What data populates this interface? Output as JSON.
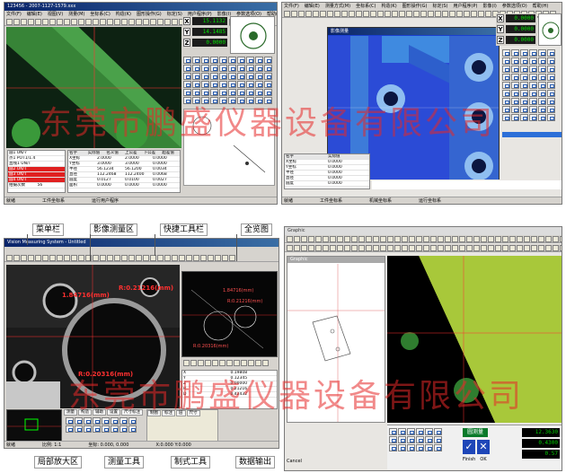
{
  "watermark": {
    "text": "东莞市鹏盛仪器设备有限公司",
    "color": "#e62828"
  },
  "panel_top_left": {
    "title": "123456 - 2007-1127-1579.xxx",
    "menu": [
      "文件(F)",
      "编辑(E)",
      "视图(V)",
      "测量(M)",
      "坐标系(C)",
      "构造(K)",
      "图形操作(G)",
      "标定(S)",
      "用户程序(P)",
      "影像(I)",
      "参数选项(O)",
      "帮助(H)"
    ],
    "readout": [
      {
        "axis": "X",
        "value": "15.1132"
      },
      {
        "axis": "Y",
        "value": "14.1485"
      },
      {
        "axis": "Z",
        "value": "0.0000"
      }
    ],
    "table_headers": [
      "名字",
      "实际值",
      "名义值",
      "上公差",
      "下公差",
      "超差值"
    ],
    "table_rows": [
      [
        "X坐标",
        "2.0000",
        "2.0000",
        "0.0000"
      ],
      [
        "Y坐标",
        "3.0000",
        "3.0000",
        "0.0000"
      ],
      [
        "半径",
        "56.1234",
        "56.1200",
        "0.0034"
      ],
      [
        "直径",
        "112.2468",
        "112.2400",
        "0.0068"
      ],
      [
        "圆度",
        "0.0127",
        "0.0100",
        "0.0027"
      ],
      [
        "面积",
        "0.0000",
        "0.0000",
        "0.0000"
      ]
    ],
    "feature_list": [
      "圆1 UN/7",
      "点1 POT1/1.4",
      "直线1 UN/T",
      "圆2 UN/T",
      "圆3 UN/T",
      "圆4 UN/T"
    ],
    "status": [
      "就绪",
      "工件坐标系",
      "运行用户程序"
    ],
    "image_count_label": "拍摄次数",
    "image_count": "56"
  },
  "panel_top_right": {
    "menu": [
      "文件(F)",
      "编辑(E)",
      "测量方式(M)",
      "坐标系(C)",
      "构造(K)",
      "图形操作(G)",
      "标定(S)",
      "用户程序(P)",
      "影像(I)",
      "参数选项(O)",
      "帮助(H)"
    ],
    "subwindow_title": "影像测量",
    "readout": [
      {
        "axis": "X",
        "value": "0.0000"
      },
      {
        "axis": "Y",
        "value": "0.0000"
      },
      {
        "axis": "Z",
        "value": "0.0000"
      }
    ],
    "table_headers": [
      "名字",
      "实际值"
    ],
    "table_rows": [
      [
        "X坐标",
        "0.0000"
      ],
      [
        "Y坐标",
        "0.0000"
      ],
      [
        "半径",
        "0.0000"
      ],
      [
        "直径",
        "0.0000"
      ],
      [
        "圆度",
        "0.0000"
      ]
    ],
    "status": [
      "就绪",
      "工件坐标系",
      "机械坐标系",
      "运行坐标系"
    ]
  },
  "panel_bottom_left": {
    "title": "Vision Measuring System - Untitled",
    "measure_labels": [
      {
        "text": "1.84716(mm)",
        "color": "#ff3030"
      },
      {
        "text": "R:0.21216(mm)",
        "color": "#ff3030"
      },
      {
        "text": "R:0.20316(mm)",
        "color": "#ff3030"
      }
    ],
    "overview_labels": [
      "1.84716(mm)",
      "R:0.21216(mm)",
      "R:0.20316(mm)"
    ],
    "readout_rows": [
      {
        "label": "X",
        "value": "0.19808"
      },
      {
        "label": "Y",
        "value": "0.12345"
      },
      {
        "label": "Z",
        "value": "0.00000"
      },
      {
        "label": "R",
        "value": "0.21216"
      },
      {
        "label": "D",
        "value": "0.42432"
      }
    ],
    "tool_tabs": [
      "测量",
      "构造",
      "辅助",
      "设置",
      "尺寸标注"
    ],
    "draw_tabs": [
      "制图",
      "标注",
      "层",
      "尺寸"
    ],
    "status": [
      "就绪",
      "比例: 1:1",
      "坐标: 0.000, 0.000",
      "X:0.000 Y:0.000"
    ],
    "callouts": [
      {
        "text": "菜单栏",
        "name": "callout-menubar"
      },
      {
        "text": "影像测量区",
        "name": "callout-image-area"
      },
      {
        "text": "快捷工具栏",
        "name": "callout-quick-toolbar"
      },
      {
        "text": "全览图",
        "name": "callout-overview"
      },
      {
        "text": "局部放大区",
        "name": "callout-zoom-area"
      },
      {
        "text": "测量工具",
        "name": "callout-measure-tools"
      },
      {
        "text": "制式工具",
        "name": "callout-draw-tools"
      },
      {
        "text": "数据输出",
        "name": "callout-data-output"
      }
    ]
  },
  "panel_bottom_right": {
    "title": "Graphic",
    "subwindow_title": "Graphic",
    "readout_values": [
      "12.3630",
      "0.4300",
      "0.57"
    ],
    "button_finish": "Finish",
    "button_ok": "OK",
    "button_cancel": "Cancel",
    "measure_button": "圆测量"
  }
}
